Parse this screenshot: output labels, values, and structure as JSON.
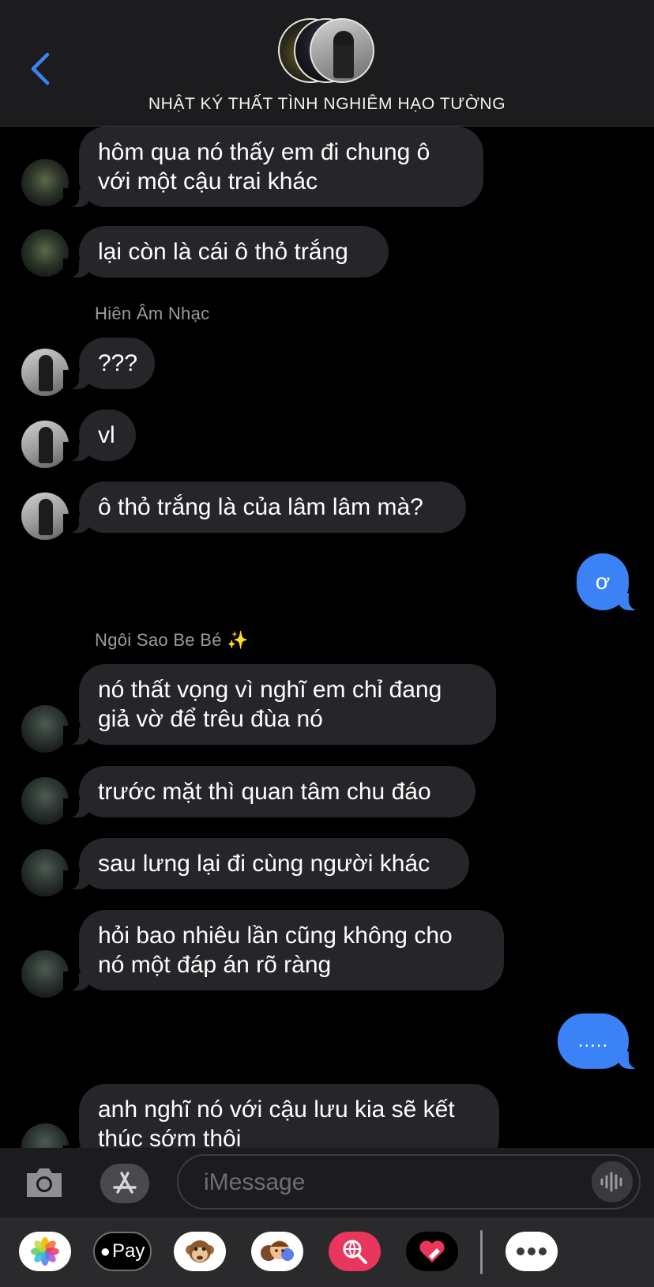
{
  "header": {
    "title": "NHẬT KÝ THẤT TÌNH NGHIÊM HẠO TƯỜNG",
    "back_icon": "chevron-left-icon"
  },
  "messages": [
    {
      "type": "received",
      "sender": "",
      "text": "hôm qua nó thấy em đi chung ô với một cậu trai khác"
    },
    {
      "type": "received",
      "sender": "",
      "text": "lại còn là cái ô thỏ trắng"
    },
    {
      "type": "sender_label",
      "text": "Hiên Âm Nhạc"
    },
    {
      "type": "received",
      "text": "???"
    },
    {
      "type": "received",
      "text": "vl"
    },
    {
      "type": "received",
      "text": "ô thỏ trắng là của lâm lâm mà?"
    },
    {
      "type": "sent",
      "text": "ơ"
    },
    {
      "type": "sender_label",
      "text": "Ngôi Sao Be Bé ✨"
    },
    {
      "type": "received",
      "text": "nó thất vọng vì nghĩ em chỉ đang giả vờ để trêu đùa nó"
    },
    {
      "type": "received",
      "text": "trước mặt thì quan tâm chu đáo"
    },
    {
      "type": "received",
      "text": "sau lưng lại đi cùng người khác"
    },
    {
      "type": "received",
      "text": "hỏi bao nhiêu lần cũng không cho nó một đáp án rõ ràng"
    },
    {
      "type": "sent",
      "text": "....."
    },
    {
      "type": "received",
      "text": "anh nghĩ nó với cậu lưu kia sẽ kết thúc sớm thôi"
    }
  ],
  "input": {
    "placeholder": "iMessage"
  },
  "app_drawer": {
    "apps": [
      "Photos",
      "Apple Pay",
      "Animoji",
      "Memoji",
      "Images",
      "Digital Touch",
      "More"
    ],
    "apple_pay_label": "Pay"
  },
  "colors": {
    "sent_bubble": "#3a82f6",
    "received_bubble": "#26262a",
    "accent": "#3a82f6"
  }
}
